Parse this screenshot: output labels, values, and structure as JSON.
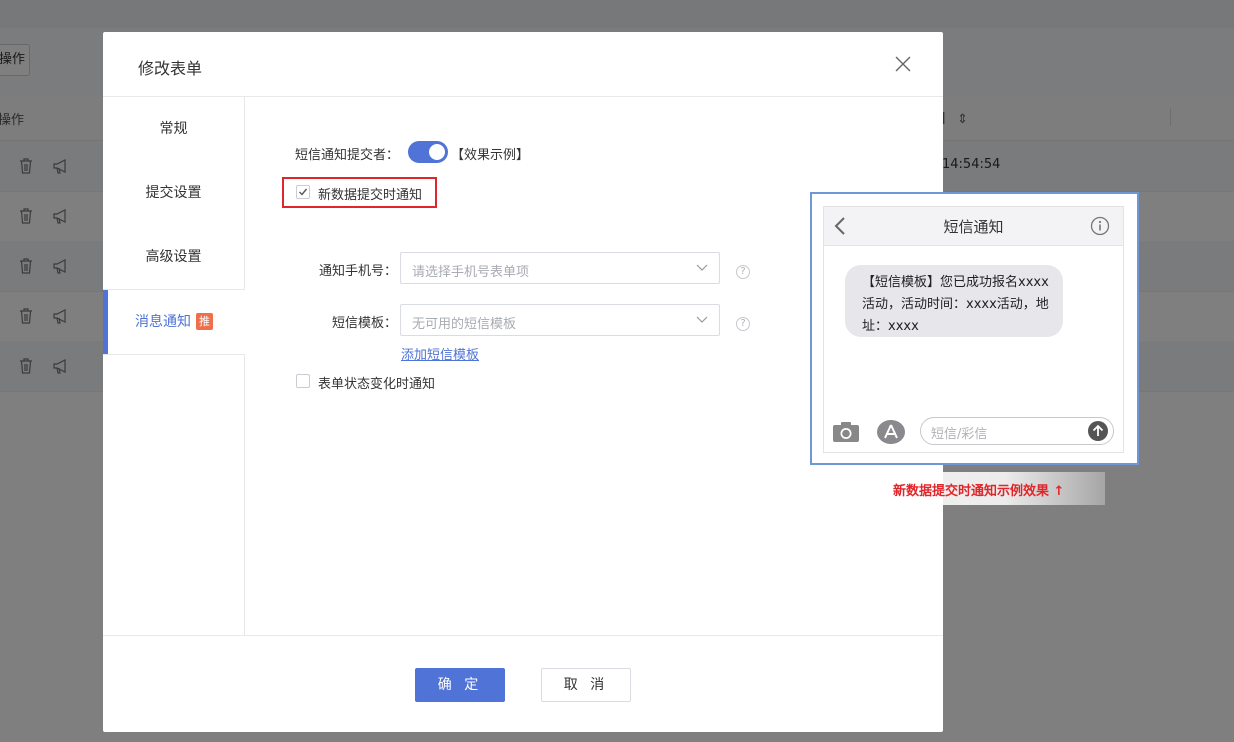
{
  "background": {
    "op_button": "操作",
    "table_header_op": "操作",
    "table_header_right": "】",
    "rows": [
      {
        "time": "14:54:54"
      },
      {
        "time": ""
      },
      {
        "time": ""
      },
      {
        "time": ""
      },
      {
        "time": ""
      }
    ]
  },
  "modal": {
    "title": "修改表单",
    "nav": [
      {
        "label": "常规"
      },
      {
        "label": "提交设置"
      },
      {
        "label": "高级设置"
      },
      {
        "label": "消息通知",
        "badge": "推"
      }
    ],
    "sms_notify_label": "短信通知提交者：",
    "sms_notify_enabled": true,
    "example_link": "【效果示例】",
    "new_data_checkbox_label": "新数据提交时通知",
    "new_data_checked": true,
    "phone_label": "通知手机号：",
    "phone_placeholder": "请选择手机号表单项",
    "template_label": "短信模板：",
    "template_placeholder": "无可用的短信模板",
    "add_template_link": "添加短信模板",
    "help_glyph": "?",
    "status_change_label": "表单状态变化时通知",
    "status_change_checked": false,
    "ok_button": "确 定",
    "cancel_button": "取 消"
  },
  "sms_example": {
    "title": "短信通知",
    "message": "【短信模板】您已成功报名xxxx活动，活动时间：xxxx活动，地址：xxxx",
    "input_placeholder": "短信/彩信",
    "caption": "新数据提交时通知示例效果 ↑"
  },
  "colors": {
    "primary": "#4f73d6",
    "highlight_red": "#e0262b",
    "badge_orange": "#ee6f4c"
  }
}
